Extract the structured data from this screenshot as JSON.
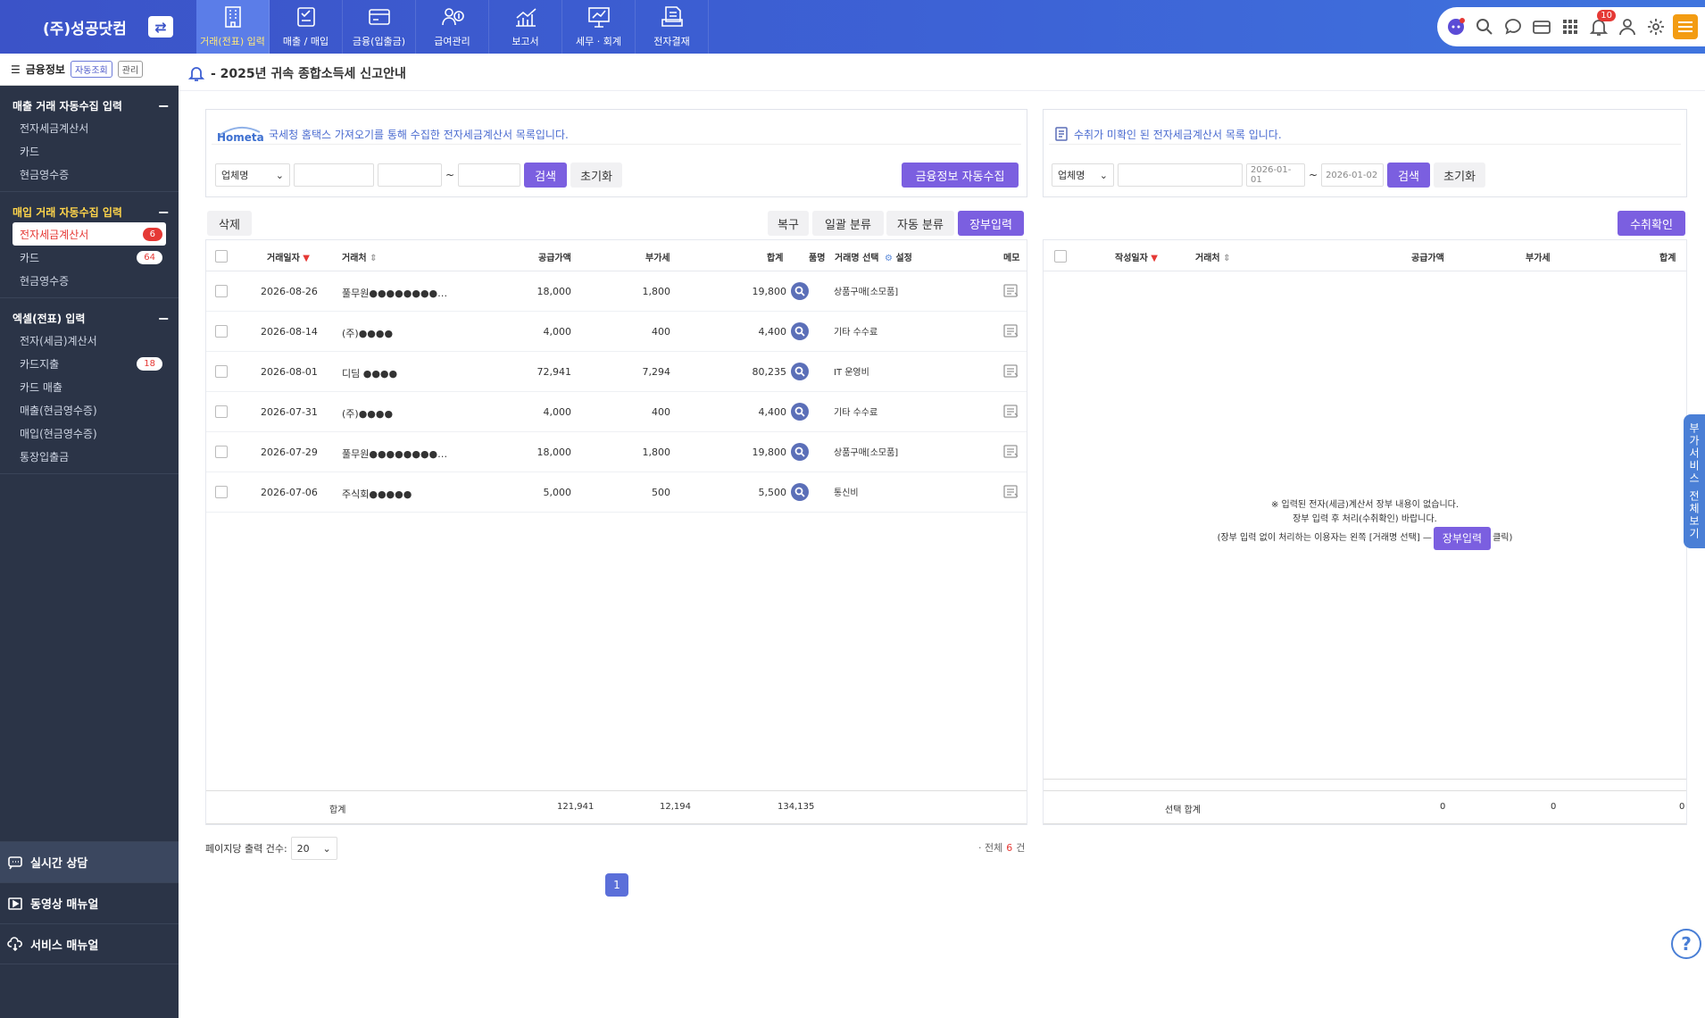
{
  "brand": {
    "name": "(주)성공닷컴"
  },
  "nav": [
    {
      "label": "거래(전표) 입력",
      "icon": "building-icon",
      "active": true
    },
    {
      "label": "매출 / 매입",
      "icon": "invoice-icon",
      "active": false
    },
    {
      "label": "금융(입출금)",
      "icon": "bank-card-icon",
      "active": false
    },
    {
      "label": "급여관리",
      "icon": "payroll-icon",
      "active": false
    },
    {
      "label": "보고서",
      "icon": "chart-report-icon",
      "active": false
    },
    {
      "label": "세무 · 회계",
      "icon": "presentation-icon",
      "active": false
    },
    {
      "label": "전자결재",
      "icon": "approval-icon",
      "active": false
    }
  ],
  "topbar": {
    "notification_count": "10"
  },
  "sidebar": {
    "head_title": "금융정보",
    "head_chip1": "자동조회",
    "head_chip2": "관리",
    "groups": [
      {
        "title": "매출 거래 자동수집 입력",
        "items": [
          {
            "label": "전자세금계산서",
            "badge": ""
          },
          {
            "label": "카드",
            "badge": ""
          },
          {
            "label": "현금영수증",
            "badge": ""
          }
        ]
      },
      {
        "title": "매입 거래 자동수집 입력",
        "items": [
          {
            "label": "전자세금계산서",
            "badge": "6"
          },
          {
            "label": "카드",
            "badge": "64"
          },
          {
            "label": "현금영수증",
            "badge": ""
          }
        ]
      },
      {
        "title": "엑셀(전표) 입력",
        "items": [
          {
            "label": "전자(세금)계산서",
            "badge": ""
          },
          {
            "label": "카드지출",
            "badge": "18"
          },
          {
            "label": "카드 매출",
            "badge": ""
          },
          {
            "label": "매출(현금영수증)",
            "badge": ""
          },
          {
            "label": "매입(현금영수증)",
            "badge": ""
          },
          {
            "label": "통장입출금",
            "badge": ""
          }
        ]
      }
    ],
    "bottom": [
      "실시간 상담",
      "동영상 매뉴얼",
      "서비스 매뉴얼"
    ]
  },
  "notice": {
    "text": "- 2025년 귀속 종합소득세 신고안내"
  },
  "left_panel": {
    "logo_text": "Hometax",
    "description": "국세청 홈택스 가져오기를 통해 수집한 전자세금계산서 목록입니다.",
    "select_value": "업체명",
    "tilde": "~",
    "search_label": "검색",
    "reset_label": "초기화",
    "auto_collect_label": "금융정보 자동수집",
    "delete_label": "삭제",
    "restore_label": "복구",
    "bulk_label": "일괄 분류",
    "auto_classify_label": "자동 분류",
    "ledger_label": "장부입력",
    "columns": {
      "date": "거래일자",
      "partner": "거래처",
      "supply": "공급가액",
      "vat": "부가세",
      "total": "합계",
      "item": "품명",
      "select": "거래명 선택",
      "setting": "설정",
      "memo": "메모"
    },
    "rows": [
      {
        "date": "2026-08-26",
        "partner": "풀무원●●●●●●●●…",
        "supply": "18,000",
        "vat": "1,800",
        "total": "19,800",
        "category": "상품구매[소모품]"
      },
      {
        "date": "2026-08-14",
        "partner": "(주)●●●●",
        "supply": "4,000",
        "vat": "400",
        "total": "4,400",
        "category": "기타 수수료"
      },
      {
        "date": "2026-08-01",
        "partner": "디딤 ●●●●",
        "supply": "72,941",
        "vat": "7,294",
        "total": "80,235",
        "category": "IT 운영비"
      },
      {
        "date": "2026-07-31",
        "partner": "(주)●●●●",
        "supply": "4,000",
        "vat": "400",
        "total": "4,400",
        "category": "기타 수수료"
      },
      {
        "date": "2026-07-29",
        "partner": "풀무원●●●●●●●●…",
        "supply": "18,000",
        "vat": "1,800",
        "total": "19,800",
        "category": "상품구매[소모품]"
      },
      {
        "date": "2026-07-06",
        "partner": "주식회●●●●●",
        "supply": "5,000",
        "vat": "500",
        "total": "5,500",
        "category": "통신비"
      }
    ],
    "footer": {
      "label": "합계",
      "supply": "121,941",
      "vat": "12,194",
      "total": "134,135"
    },
    "page_size_label": "페이지당 출력 건수:",
    "page_size_value": "20",
    "total_prefix": "· 전체",
    "total_count": "6",
    "total_suffix": "건",
    "current_page": "1"
  },
  "right_panel": {
    "description": "수취가 미확인 된 전자세금계산서 목록 입니다.",
    "select_value": "업체명",
    "date_from": "2026-01-01",
    "tilde": "~",
    "date_to": "2026-01-02",
    "search_label": "검색",
    "reset_label": "초기화",
    "confirm_label": "수취확인",
    "columns": {
      "date": "작성일자",
      "partner": "거래처",
      "supply": "공급가액",
      "vat": "부가세",
      "total": "합계"
    },
    "empty_line1": "※ 입력된 전자(세금)계산서 장부 내용이 없습니다.",
    "empty_line2": "장부 입력 후 처리(수취확인) 바랍니다.",
    "empty_line3_pre": "(장부 입력 없이 처리하는 이용자는 왼쪽 [거래명 선택] —",
    "empty_line3_btn": "장부입력",
    "empty_line3_post": "클릭)",
    "footer": {
      "label": "선택 합계",
      "supply": "0",
      "vat": "0",
      "total": "0"
    }
  },
  "side_tab": {
    "label": "부가서비스 전체보기"
  },
  "help": {
    "label": "?"
  },
  "colors": {
    "primary": "#7b5fe0",
    "topbar": "#3d5fd3",
    "sidebar": "#2b3447",
    "badge": "#e53935"
  }
}
